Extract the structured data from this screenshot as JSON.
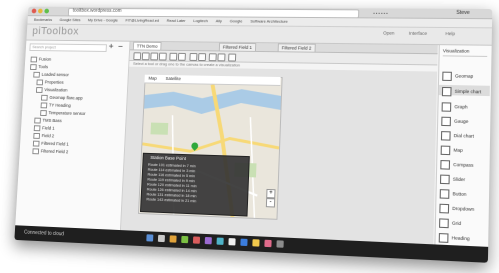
{
  "browser": {
    "url": "tooltbox.wordpress.com",
    "bookmarks": [
      "Bookmarks",
      "Google Sites",
      "My Drive - Google",
      "FIT@LivingRead.ed",
      "Read Later",
      "Logitech",
      "Ally",
      "Google",
      "Software Architecture"
    ],
    "user": "Steve"
  },
  "app": {
    "title": "piToolbox",
    "header_links": [
      "Open",
      "Interface",
      "Help"
    ]
  },
  "left_panel": {
    "search_placeholder": "Search project",
    "plus": "+",
    "minus": "−",
    "tree": [
      "Fusion",
      "Tools",
      "Loaded sensor",
      "Properties",
      "Visualization",
      "Geomap flare.app",
      "TY Heading",
      "Temperature sensor",
      "TMS Bass",
      "Field 1",
      "Field 2",
      "Filtered Field 1",
      "Filtered Field 2"
    ]
  },
  "center": {
    "tabs": [
      "TTN Demo",
      "Filtered Field 1",
      "Filtered Field 2"
    ],
    "hint": "Select a tool or drag one to the canvas to create a visualization",
    "map_tabs": [
      "Map",
      "Satellite"
    ],
    "popup": {
      "title": "Station Base Point",
      "lines": [
        "Route 101 estimated in 7 min",
        "Route 114 estimated in 3 min",
        "Route 116 estimated in 5 min",
        "Route 119 estimated in 9 min",
        "Route 120 estimated in 11 min",
        "Route 126 estimated in 14 min",
        "Route 131 estimated in 18 min",
        "Route 143 estimated in 21 min"
      ]
    }
  },
  "right_panel": {
    "title": "Visualization",
    "items": [
      "Geomap",
      "Simple chart",
      "Graph",
      "Gauge",
      "Dial chart",
      "Map",
      "Compass",
      "Slider",
      "Button",
      "Dropdown",
      "Grid",
      "Heading"
    ]
  },
  "taskbar": {
    "status": "Connected to cloud"
  },
  "colors": {
    "map_water": "#aacbe6",
    "map_road": "#f7d977",
    "marker": "#2fa83a",
    "popup_bg": "#343434"
  }
}
